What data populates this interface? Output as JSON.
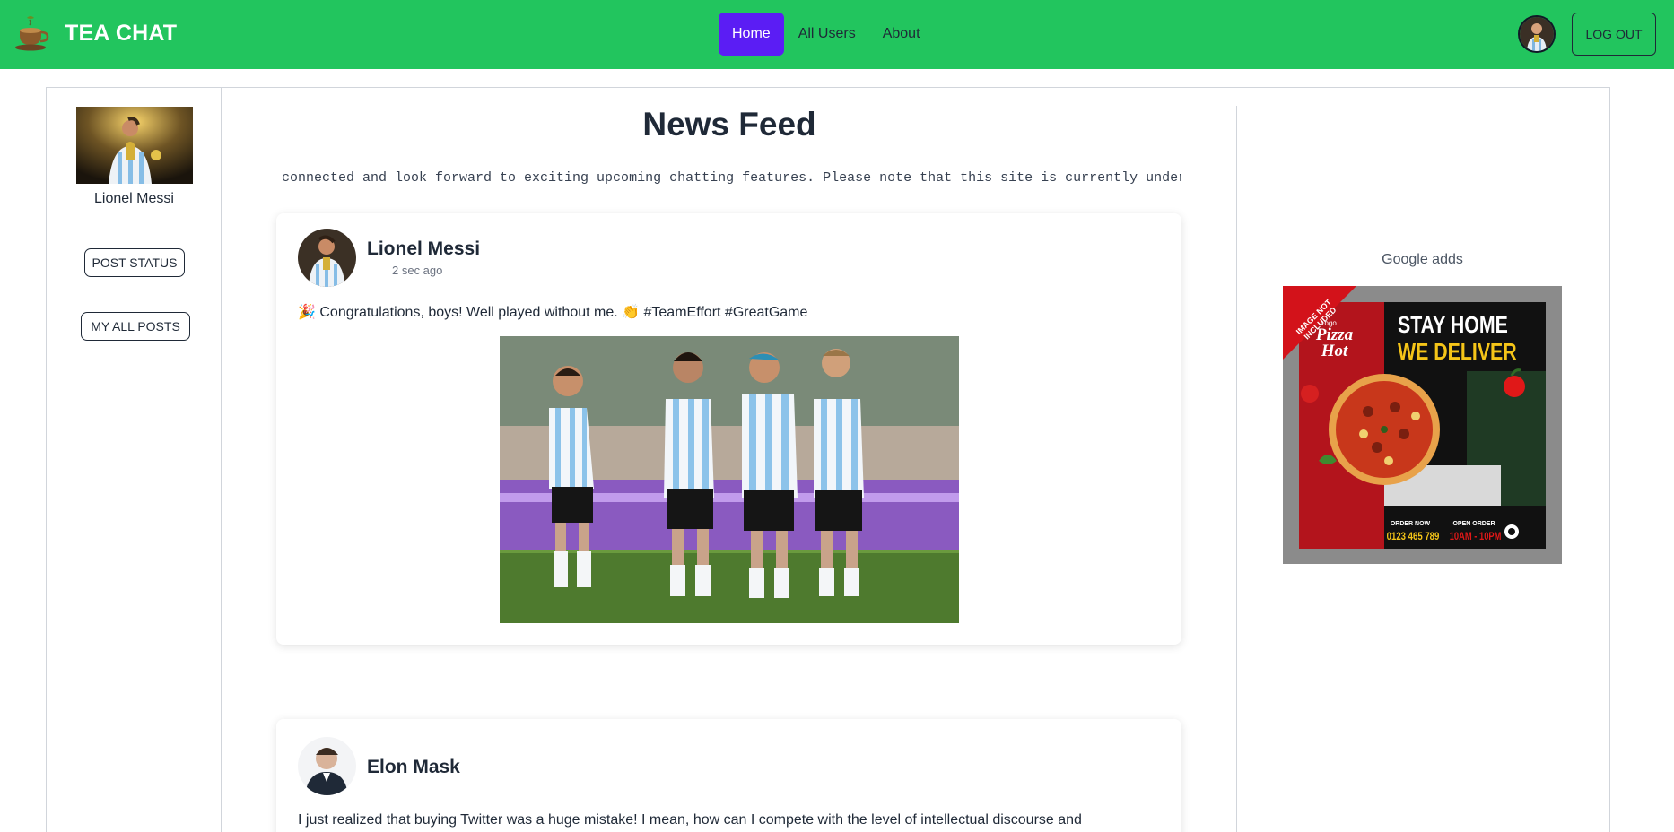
{
  "navbar": {
    "brand": "TEA CHAT",
    "links": [
      {
        "label": "Home",
        "active": true
      },
      {
        "label": "All Users",
        "active": false
      },
      {
        "label": "About",
        "active": false
      }
    ],
    "logout_label": "LOG OUT",
    "accent_color": "#22c55e",
    "active_link_color": "#5b1df4"
  },
  "sidebar": {
    "profile_name": "Lionel Messi",
    "post_status_label": "POST STATUS",
    "my_all_posts_label": "MY ALL POSTS"
  },
  "feed": {
    "title": "News Feed",
    "marquee": "connected and look forward to exciting upcoming chatting features. Please note that this site is currently under d",
    "posts": [
      {
        "author": "Lionel Messi",
        "time": "2 sec ago",
        "text": "🎉 Congratulations, boys! Well played without me. 👏 #TeamEffort #GreatGame"
      },
      {
        "author": "Elon Mask",
        "time": "",
        "text": "I just realized that buying Twitter was a huge mistake! I mean, how can I compete with the level of intellectual discourse and"
      }
    ]
  },
  "ads": {
    "title": "Google adds",
    "banner": {
      "corner": "IMAGE NOT INCLUDED",
      "logo_small": "Logo",
      "logo_main": "Pizza Hot",
      "headline_1": "STAY HOME",
      "headline_2": "WE DELIVER",
      "order_label": "ORDER NOW",
      "phone": "0123 465 789",
      "open_label": "OPEN ORDER",
      "hours": "10AM - 10PM"
    }
  }
}
